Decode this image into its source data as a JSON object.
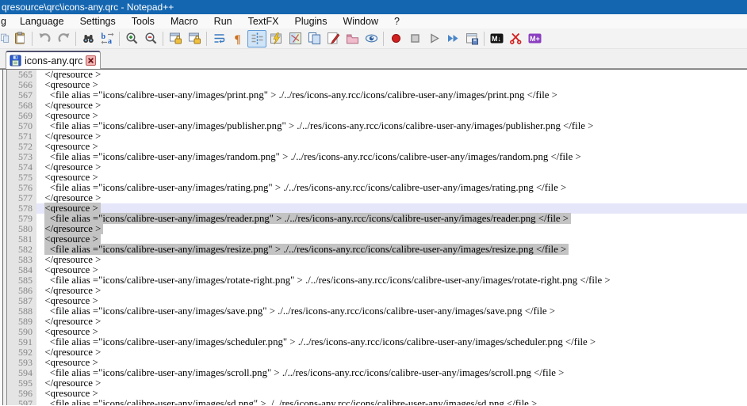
{
  "window": {
    "title": "qresource\\qrc\\icons-any.qrc - Notepad++"
  },
  "menubar": {
    "items": [
      "g",
      "Language",
      "Settings",
      "Tools",
      "Macro",
      "Run",
      "TextFX",
      "Plugins",
      "Window",
      "?"
    ]
  },
  "toolbar": {
    "items": [
      {
        "name": "copy-icon",
        "partial": true
      },
      {
        "name": "paste-icon"
      },
      {
        "sep": true
      },
      {
        "name": "undo-icon"
      },
      {
        "name": "redo-icon"
      },
      {
        "sep": true
      },
      {
        "name": "find-icon"
      },
      {
        "name": "replace-icon"
      },
      {
        "sep": true
      },
      {
        "name": "zoom-in-icon"
      },
      {
        "name": "zoom-out-icon"
      },
      {
        "sep": true
      },
      {
        "name": "sync-vertical-scroll-icon"
      },
      {
        "name": "sync-horizontal-scroll-icon"
      },
      {
        "sep": true
      },
      {
        "name": "word-wrap-icon"
      },
      {
        "name": "show-all-characters-icon"
      },
      {
        "name": "indent-guide-icon",
        "active": true
      },
      {
        "name": "function-list-icon"
      },
      {
        "name": "document-map-icon"
      },
      {
        "name": "document-switcher-icon"
      },
      {
        "name": "edit-marker-icon"
      },
      {
        "name": "folder-as-workspace-icon"
      },
      {
        "name": "file-monitoring-icon"
      },
      {
        "sep": true
      },
      {
        "name": "macro-record-icon"
      },
      {
        "name": "macro-stop-icon"
      },
      {
        "name": "macro-play-icon"
      },
      {
        "name": "macro-run-multiple-icon"
      },
      {
        "name": "macro-save-icon"
      },
      {
        "sep": true
      },
      {
        "name": "markdown-viewer-icon"
      },
      {
        "name": "plugin-scissors-icon"
      },
      {
        "name": "markdown-plus-icon"
      }
    ]
  },
  "tabbar": {
    "tabs": [
      {
        "label": "icons-any.qrc",
        "active": true,
        "saved": true
      }
    ]
  },
  "editor": {
    "selection_color": "#c3c3c3",
    "current_line_color": "#e6e6fa",
    "lines": [
      {
        "n": 565,
        "t": "  </qresource >"
      },
      {
        "n": 566,
        "t": "  <qresource >"
      },
      {
        "n": 567,
        "t": "    <file alias =\"icons/calibre-user-any/images/print.png\" > ./../res/icons-any.rcc/icons/calibre-user-any/images/print.png </file >"
      },
      {
        "n": 568,
        "t": "  </qresource >"
      },
      {
        "n": 569,
        "t": "  <qresource >"
      },
      {
        "n": 570,
        "t": "    <file alias =\"icons/calibre-user-any/images/publisher.png\" > ./../res/icons-any.rcc/icons/calibre-user-any/images/publisher.png </file >"
      },
      {
        "n": 571,
        "t": "  </qresource >"
      },
      {
        "n": 572,
        "t": "  <qresource >"
      },
      {
        "n": 573,
        "t": "    <file alias =\"icons/calibre-user-any/images/random.png\" > ./../res/icons-any.rcc/icons/calibre-user-any/images/random.png </file >"
      },
      {
        "n": 574,
        "t": "  </qresource >"
      },
      {
        "n": 575,
        "t": "  <qresource >"
      },
      {
        "n": 576,
        "t": "    <file alias =\"icons/calibre-user-any/images/rating.png\" > ./../res/icons-any.rcc/icons/calibre-user-any/images/rating.png </file >"
      },
      {
        "n": 577,
        "t": "  </qresource >"
      },
      {
        "n": 578,
        "t": "  <qresource >",
        "s": true,
        "c": true
      },
      {
        "n": 579,
        "t": "    <file alias =\"icons/calibre-user-any/images/reader.png\" > ./../res/icons-any.rcc/icons/calibre-user-any/images/reader.png </file >",
        "s": true
      },
      {
        "n": 580,
        "t": "  </qresource >",
        "s": true
      },
      {
        "n": 581,
        "t": "  <qresource >",
        "s": true
      },
      {
        "n": 582,
        "t": "    <file alias =\"icons/calibre-user-any/images/resize.png\" > ./../res/icons-any.rcc/icons/calibre-user-any/images/resize.png </file >",
        "s": true
      },
      {
        "n": 583,
        "t": "  </qresource >"
      },
      {
        "n": 584,
        "t": "  <qresource >"
      },
      {
        "n": 585,
        "t": "    <file alias =\"icons/calibre-user-any/images/rotate-right.png\" > ./../res/icons-any.rcc/icons/calibre-user-any/images/rotate-right.png </file >"
      },
      {
        "n": 586,
        "t": "  </qresource >"
      },
      {
        "n": 587,
        "t": "  <qresource >"
      },
      {
        "n": 588,
        "t": "    <file alias =\"icons/calibre-user-any/images/save.png\" > ./../res/icons-any.rcc/icons/calibre-user-any/images/save.png </file >"
      },
      {
        "n": 589,
        "t": "  </qresource >"
      },
      {
        "n": 590,
        "t": "  <qresource >"
      },
      {
        "n": 591,
        "t": "    <file alias =\"icons/calibre-user-any/images/scheduler.png\" > ./../res/icons-any.rcc/icons/calibre-user-any/images/scheduler.png </file >"
      },
      {
        "n": 592,
        "t": "  </qresource >"
      },
      {
        "n": 593,
        "t": "  <qresource >"
      },
      {
        "n": 594,
        "t": "    <file alias =\"icons/calibre-user-any/images/scroll.png\" > ./../res/icons-any.rcc/icons/calibre-user-any/images/scroll.png </file >"
      },
      {
        "n": 595,
        "t": "  </qresource >"
      },
      {
        "n": 596,
        "t": "  <qresource >"
      },
      {
        "n": 597,
        "t": "    <file alias =\"icons/calibre-user-any/images/sd.png\" > ./../res/icons-any.rcc/icons/calibre-user-any/images/sd.png </file >"
      }
    ]
  },
  "colors": {
    "titlebar": "#1466b0",
    "menubar_bg": "#f9f9f9",
    "toolbar_bg": "#f3f3f3",
    "gutter_bg": "#e4e4e4",
    "gutter_fg": "#858585",
    "selection": "#c3c3c3",
    "current_line": "#e6e6fa"
  }
}
